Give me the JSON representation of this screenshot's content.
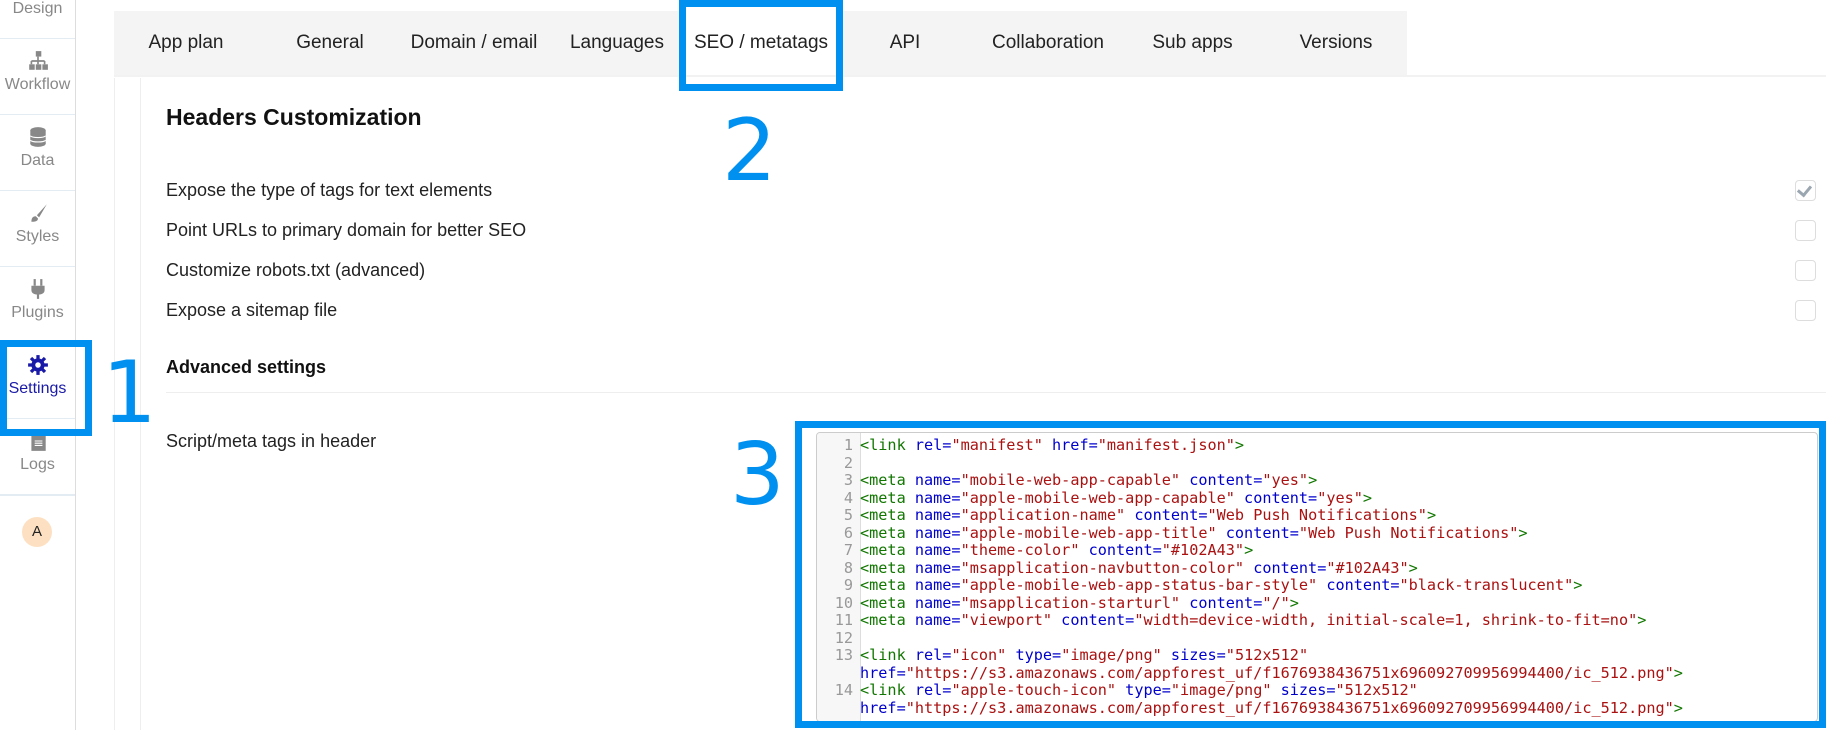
{
  "sidebar": {
    "items": [
      {
        "label": "Design",
        "icon": "brush-pencil-icon"
      },
      {
        "label": "Workflow",
        "icon": "sitemap-icon"
      },
      {
        "label": "Data",
        "icon": "database-icon"
      },
      {
        "label": "Styles",
        "icon": "paintbrush-icon"
      },
      {
        "label": "Plugins",
        "icon": "plug-icon"
      },
      {
        "label": "Settings",
        "icon": "gear-icon",
        "active": true
      },
      {
        "label": "Logs",
        "icon": "document-icon"
      }
    ],
    "avatar": "A"
  },
  "tabs": [
    {
      "label": "App plan"
    },
    {
      "label": "General"
    },
    {
      "label": "Domain / email"
    },
    {
      "label": "Languages"
    },
    {
      "label": "SEO / metatags",
      "active": true
    },
    {
      "label": "API"
    },
    {
      "label": "Collaboration"
    },
    {
      "label": "Sub apps"
    },
    {
      "label": "Versions"
    }
  ],
  "annotations": {
    "one": "1",
    "two": "2",
    "three": "3",
    "color": "#0090f0"
  },
  "section": {
    "title": "Headers Customization",
    "options": [
      {
        "label": "Expose the type of tags for text elements",
        "checked": true
      },
      {
        "label": "Point URLs to primary domain for better SEO",
        "checked": false
      },
      {
        "label": "Customize robots.txt (advanced)",
        "checked": false
      },
      {
        "label": "Expose a sitemap file",
        "checked": false
      }
    ],
    "advanced_title": "Advanced settings",
    "script_label": "Script/meta tags in header"
  },
  "editor": {
    "lines": [
      {
        "n": "1",
        "code": "<link rel=\"manifest\" href=\"manifest.json\">"
      },
      {
        "n": "2",
        "code": ""
      },
      {
        "n": "3",
        "code": "<meta name=\"mobile-web-app-capable\" content=\"yes\">"
      },
      {
        "n": "4",
        "code": "<meta name=\"apple-mobile-web-app-capable\" content=\"yes\">"
      },
      {
        "n": "5",
        "code": "<meta name=\"application-name\" content=\"Web Push Notifications\">"
      },
      {
        "n": "6",
        "code": "<meta name=\"apple-mobile-web-app-title\" content=\"Web Push Notifications\">"
      },
      {
        "n": "7",
        "code": "<meta name=\"theme-color\" content=\"#102A43\">"
      },
      {
        "n": "8",
        "code": "<meta name=\"msapplication-navbutton-color\" content=\"#102A43\">"
      },
      {
        "n": "9",
        "code": "<meta name=\"apple-mobile-web-app-status-bar-style\" content=\"black-translucent\">"
      },
      {
        "n": "10",
        "code": "<meta name=\"msapplication-starturl\" content=\"/\">"
      },
      {
        "n": "11",
        "code": "<meta name=\"viewport\" content=\"width=device-width, initial-scale=1, shrink-to-fit=no\">"
      },
      {
        "n": "12",
        "code": ""
      },
      {
        "n": "13",
        "code": "<link rel=\"icon\" type=\"image/png\" sizes=\"512x512\""
      },
      {
        "n": "",
        "code": "href=\"https://s3.amazonaws.com/appforest_uf/f1676938436751x696092709956994400/ic_512.png\">"
      },
      {
        "n": "14",
        "code": "<link rel=\"apple-touch-icon\" type=\"image/png\" sizes=\"512x512\""
      },
      {
        "n": "",
        "code": "href=\"https://s3.amazonaws.com/appforest_uf/f1676938436751x696092709956994400/ic_512.png\">"
      }
    ]
  }
}
